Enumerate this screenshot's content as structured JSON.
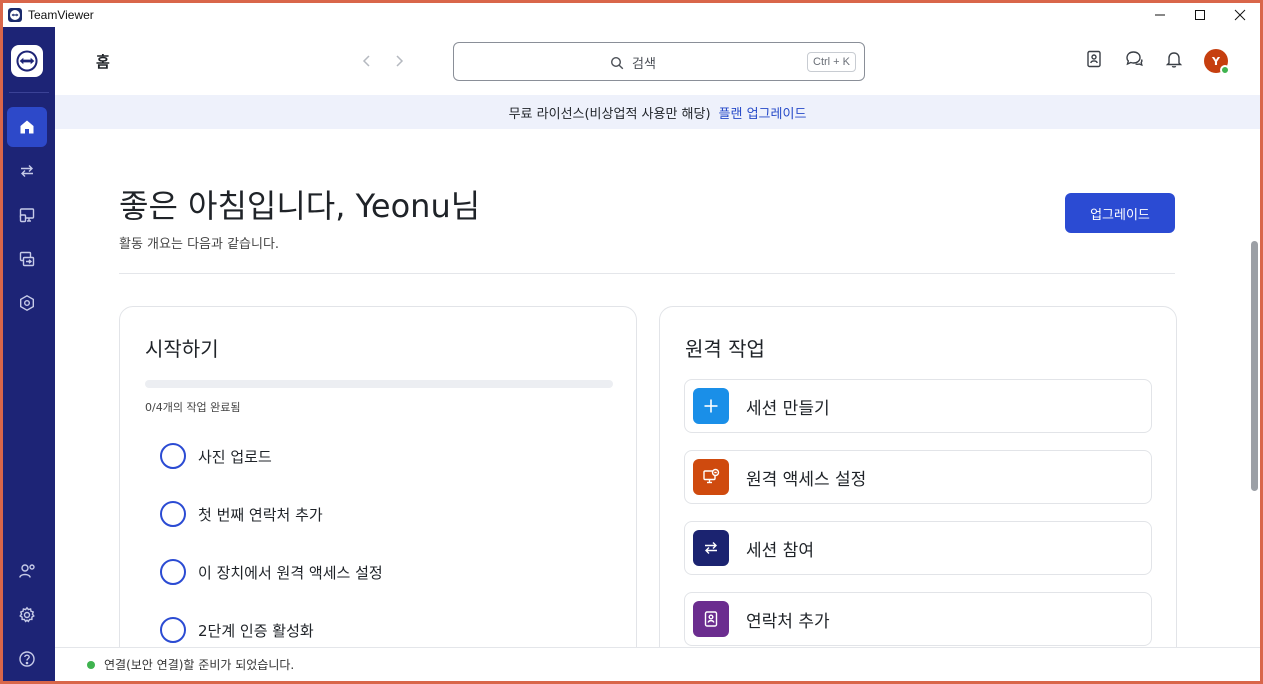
{
  "window": {
    "title": "TeamViewer"
  },
  "header": {
    "page_title": "홈",
    "search_placeholder": "검색",
    "search_shortcut": "Ctrl + K",
    "avatar_initial": "Y"
  },
  "banner": {
    "text": "무료 라이선스(비상업적 사용만 해당)",
    "link": "플랜 업그레이드"
  },
  "greeting": {
    "title": "좋은 아침입니다, Yeonu님",
    "subtitle": "활동 개요는 다음과 같습니다.",
    "upgrade_label": "업그레이드"
  },
  "getting_started": {
    "title": "시작하기",
    "progress_label": "0/4개의 작업 완료됨",
    "progress_fraction": 0,
    "tasks": [
      {
        "label": "사진 업로드"
      },
      {
        "label": "첫 번째 연락처 추가"
      },
      {
        "label": "이 장치에서 원격 액세스 설정"
      },
      {
        "label": "2단계 인증 활성화"
      }
    ]
  },
  "remote_work": {
    "title": "원격 작업",
    "actions": [
      {
        "label": "세션 만들기",
        "icon": "plus-icon",
        "color": "#1a8fe8"
      },
      {
        "label": "원격 액세스 설정",
        "icon": "remote-monitor-icon",
        "color": "#cf4a0e"
      },
      {
        "label": "세션 참여",
        "icon": "transfer-arrows-icon",
        "color": "#1b2370"
      },
      {
        "label": "연락처 추가",
        "icon": "contact-book-icon",
        "color": "#6b2d8f"
      }
    ]
  },
  "status": {
    "text": "연결(보안 연결)할 준비가 되었습니다."
  },
  "colors": {
    "sidebar": "#1d2476",
    "accent": "#2b4bd3",
    "link": "#2549c8",
    "online": "#3fb34f"
  }
}
